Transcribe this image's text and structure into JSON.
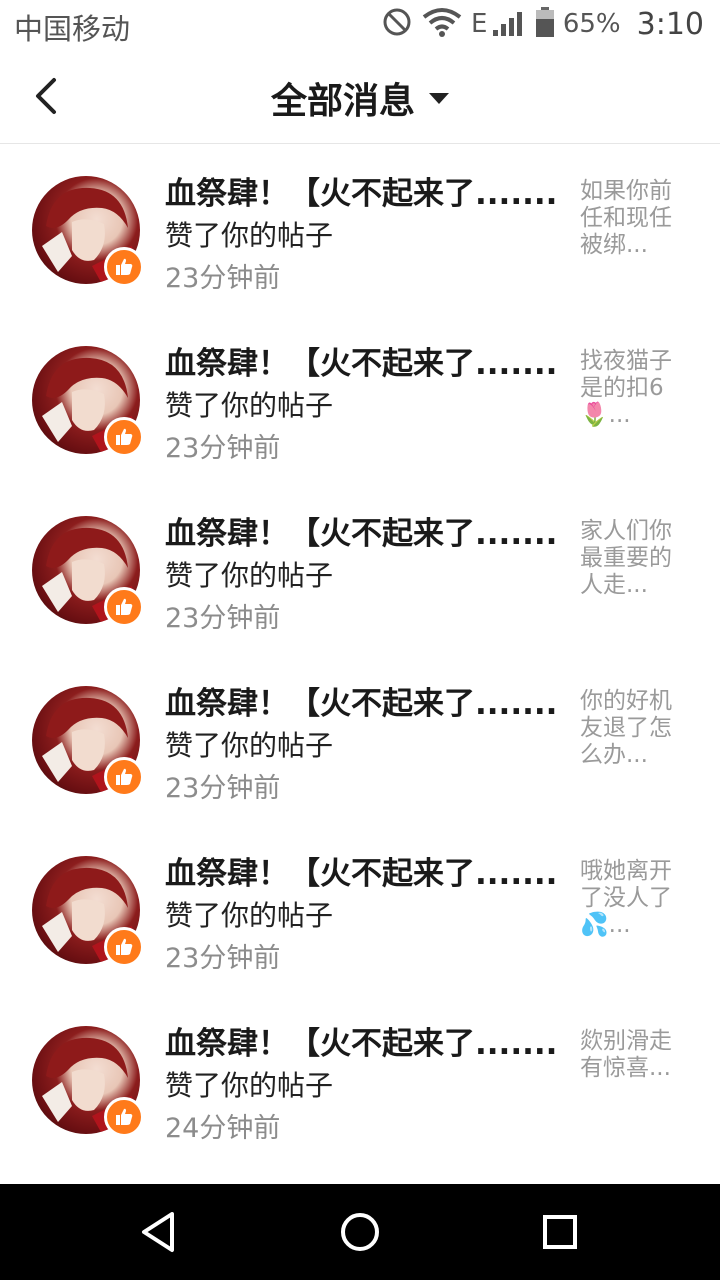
{
  "status_bar": {
    "carrier": "中国移动",
    "battery": "65%",
    "time": "3:10",
    "network": "E"
  },
  "header": {
    "title": "全部消息"
  },
  "messages": [
    {
      "name": "血祭肆！【火不起来了........",
      "action": "赞了你的帖子",
      "time": "23分钟前",
      "preview": "如果你前任和现任被绑..."
    },
    {
      "name": "血祭肆！【火不起来了........",
      "action": "赞了你的帖子",
      "time": "23分钟前",
      "preview": "找夜猫子是的扣6🌷..."
    },
    {
      "name": "血祭肆！【火不起来了........",
      "action": "赞了你的帖子",
      "time": "23分钟前",
      "preview": "家人们你最重要的人走..."
    },
    {
      "name": "血祭肆！【火不起来了........",
      "action": "赞了你的帖子",
      "time": "23分钟前",
      "preview": "你的好机友退了怎么办..."
    },
    {
      "name": "血祭肆！【火不起来了........",
      "action": "赞了你的帖子",
      "time": "23分钟前",
      "preview": "哦她离开了没人了💦..."
    },
    {
      "name": "血祭肆！【火不起来了........",
      "action": "赞了你的帖子",
      "time": "24分钟前",
      "preview": "欻别滑走有惊喜..."
    }
  ],
  "colors": {
    "like_badge": "#ff7a1a",
    "time_text": "#8c8c8c",
    "preview_text": "#9a9a9a",
    "nav_bar": "#000000"
  },
  "icons": {
    "back": "chevron-left-icon",
    "dropdown": "caret-down-icon",
    "like": "thumbs-up-icon",
    "nav_back": "triangle-back-icon",
    "nav_home": "circle-home-icon",
    "nav_recent": "square-recents-icon"
  }
}
